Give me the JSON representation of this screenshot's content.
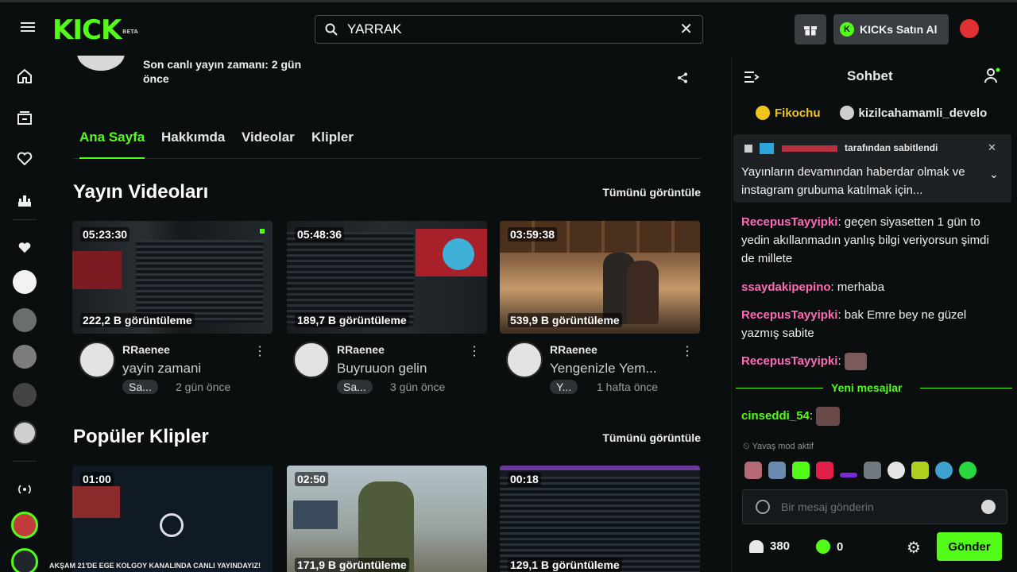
{
  "header": {
    "logo": "KICK",
    "logo_badge": "BETA",
    "search_value": "YARRAK",
    "kicks_button": "KICKs Satın Al"
  },
  "profile": {
    "last_live": "Son canlı yayın zamanı: 2 gün önce"
  },
  "tabs": [
    "Ana Sayfa",
    "Hakkımda",
    "Videolar",
    "Klipler"
  ],
  "videos_section": {
    "title": "Yayın Videoları",
    "see_all": "Tümünü görüntüle",
    "items": [
      {
        "duration": "05:23:30",
        "views": "222,2 B görüntüleme",
        "channel": "RRaenee",
        "title": "yayin zamani",
        "tag": "Sa...",
        "time": "2 gün önce"
      },
      {
        "duration": "05:48:36",
        "views": "189,7 B görüntüleme",
        "channel": "RRaenee",
        "title": "Buyruuon gelin",
        "tag": "Sa...",
        "time": "3 gün önce"
      },
      {
        "duration": "03:59:38",
        "views": "539,9 B görüntüleme",
        "channel": "RRaenee",
        "title": "Yengenizle Yem...",
        "tag": "Y...",
        "time": "1 hafta önce"
      }
    ]
  },
  "clips_section": {
    "title": "Popüler Klipler",
    "see_all": "Tümünü görüntüle",
    "items": [
      {
        "duration": "01:00",
        "views": ""
      },
      {
        "duration": "02:50",
        "views": "171,9 B görüntüleme"
      },
      {
        "duration": "00:18",
        "views": "129,1 B görüntüleme"
      }
    ]
  },
  "chat": {
    "title": "Sohbet",
    "gifters": [
      "Fikochu",
      "kizilcahamamli_develo"
    ],
    "pinned_by": "tarafından sabitlendi",
    "pinned_text": "Yayınların devamından haberdar olmak ve instagram grubuma katılmak için...",
    "messages": [
      {
        "user": "RecepusTayyipki",
        "text": "geçen siyasetten 1 gün to yedin akıllanmadın yanlış bilgi veriyorsun şimdi de millete",
        "color": "#ff6bb5"
      },
      {
        "user": "ssaydakipepino",
        "text": "merhaba",
        "color": "#ff6bb5"
      },
      {
        "user": "RecepusTayyipki",
        "text": "bak Emre bey ne güzel yazmış sabite",
        "color": "#ff6bb5"
      },
      {
        "user": "RecepusTayyipki",
        "text": "",
        "color": "#ff6bb5"
      }
    ],
    "new_messages": "Yeni mesajlar",
    "after_messages": [
      {
        "user": "cinseddi_54",
        "text": "",
        "color": "#53fc18"
      }
    ],
    "slow_mode": "Yavaş mod aktif",
    "input_placeholder": "Bir mesaj gönderin",
    "viewers": "380",
    "kicks": "0",
    "send": "Gönder"
  },
  "banner": "AKŞAM 21'DE EGE KOLGOY KANALINDA CANLI YAYINDAYIZ!",
  "colors": {
    "accent": "#53fc18",
    "bg": "#0b0e0f",
    "highlight_user": "#ff6bb5"
  }
}
